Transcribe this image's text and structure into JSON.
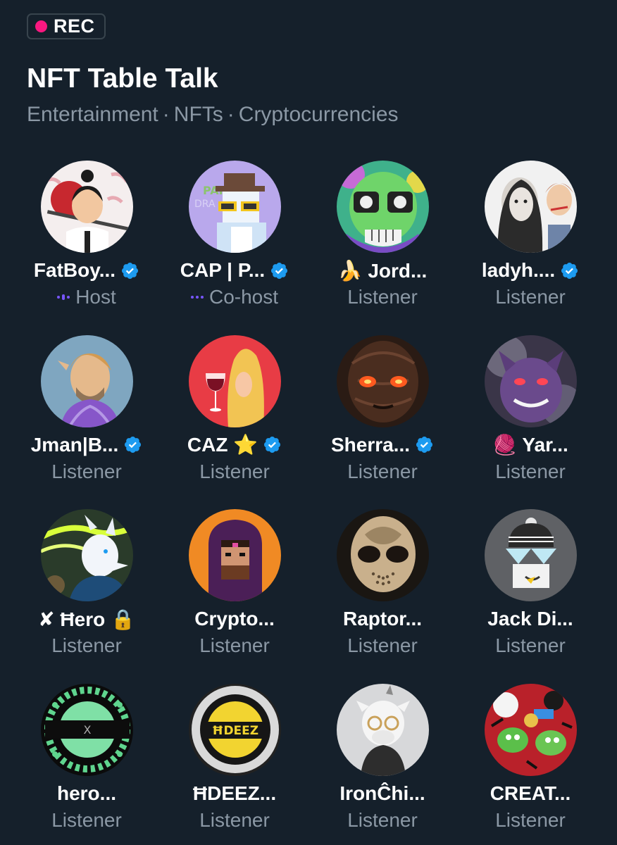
{
  "rec": {
    "label": "REC",
    "color": "#f91880"
  },
  "space": {
    "title": "NFT Table Talk",
    "topics": [
      "Entertainment",
      "NFTs",
      "Cryptocurrencies"
    ],
    "topic_separator": "·"
  },
  "participants": [
    {
      "name": "FatBoy...",
      "role": "Host",
      "verified": true,
      "speaker_icon": "host-audio-icon"
    },
    {
      "name": "CAP | P...",
      "role": "Co-host",
      "verified": true,
      "speaker_icon": "cohost-audio-icon"
    },
    {
      "name": "🍌 Jord...",
      "role": "Listener",
      "verified": false
    },
    {
      "name": "ladyh....",
      "role": "Listener",
      "verified": true
    },
    {
      "name": "Jman|B...",
      "role": "Listener",
      "verified": true
    },
    {
      "name": "CAZ ⭐",
      "role": "Listener",
      "verified": true
    },
    {
      "name": "Sherra...",
      "role": "Listener",
      "verified": true
    },
    {
      "name": "🧶 Yar...",
      "role": "Listener",
      "verified": false
    },
    {
      "name": "✘ Ħero 🔒",
      "role": "Listener",
      "verified": false
    },
    {
      "name": "Crypto...",
      "role": "Listener",
      "verified": false
    },
    {
      "name": "Raptor...",
      "role": "Listener",
      "verified": false
    },
    {
      "name": "Jack Di...",
      "role": "Listener",
      "verified": false
    },
    {
      "name": "hero...",
      "role": "Listener",
      "verified": false
    },
    {
      "name": "ĦDEEZ...",
      "role": "Listener",
      "verified": false
    },
    {
      "name": "IronĈhi...",
      "role": "Listener",
      "verified": false
    },
    {
      "name": "CREAT...",
      "role": "Listener",
      "verified": false
    }
  ],
  "colors": {
    "background": "#15202b",
    "verified": "#1d9bf0",
    "secondary_text": "#8b98a5",
    "speaker_accent": "#7856ff"
  }
}
